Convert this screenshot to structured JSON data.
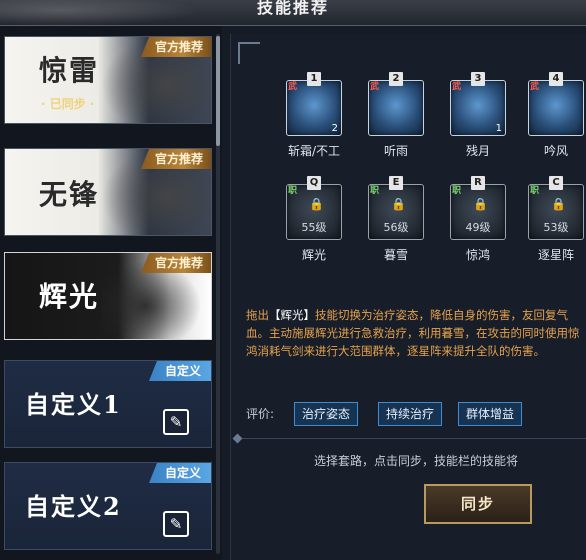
{
  "header": {
    "title": "技能推荐"
  },
  "loadouts": [
    {
      "name": "惊雷",
      "tag": "官方推荐",
      "status": "· 已同步 ·"
    },
    {
      "name": "无锋",
      "tag": "官方推荐"
    },
    {
      "name": "辉光",
      "tag": "官方推荐"
    },
    {
      "name": "自定义1",
      "tag": "自定义"
    },
    {
      "name": "自定义2",
      "tag": "自定义"
    }
  ],
  "skills_row1": [
    {
      "key": "1",
      "type": "武",
      "count": "2",
      "label": "斩霜/不工"
    },
    {
      "key": "2",
      "type": "武",
      "count": "",
      "label": "听雨"
    },
    {
      "key": "3",
      "type": "武",
      "count": "1",
      "label": "残月"
    },
    {
      "key": "4",
      "type": "武",
      "count": "",
      "label": "吟风"
    }
  ],
  "skills_row2": [
    {
      "key": "Q",
      "type": "职",
      "level": "55级",
      "label": "辉光"
    },
    {
      "key": "E",
      "type": "职",
      "level": "56级",
      "label": "暮雪"
    },
    {
      "key": "R",
      "type": "职",
      "level": "49级",
      "label": "惊鸿"
    },
    {
      "key": "C",
      "type": "职",
      "level": "53级",
      "label": "逐星阵"
    }
  ],
  "description": {
    "prefix": "拖出",
    "highlight": "【辉光】",
    "text": "技能切换为治疗姿态，降低自身的伤害，友回复气血。主动施展辉光进行急救治疗，利用暮雪，在攻击的同时使用惊鸿消耗气剑来进行大范围群体，逐星阵来提升全队的伤害。"
  },
  "rating": {
    "label": "评价:",
    "tags": [
      "治疗姿态",
      "持续治疗",
      "群体增益"
    ]
  },
  "hint": "选择套路，点击同步，技能栏的技能将",
  "sync_button": "同步",
  "colors": {
    "official_tag": "#b7843c",
    "custom_tag": "#5aa6e4",
    "desc_text": "#e6a24c",
    "rating_border": "#3f8bd0"
  }
}
